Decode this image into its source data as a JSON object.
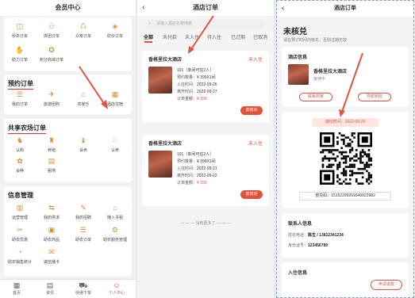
{
  "p1": {
    "title": "会员中心",
    "top_items": [
      {
        "label": "秒杀订单",
        "icon": "bag-icon"
      },
      {
        "label": "拼团订单",
        "icon": "group-icon"
      },
      {
        "label": "众筹订单",
        "icon": "crowd-icon"
      },
      {
        "label": "砍价订单",
        "icon": "tag-icon"
      },
      {
        "label": "助力订单",
        "icon": "hand-icon"
      },
      {
        "label": "积分商城订单",
        "icon": "points-icon"
      }
    ],
    "booking_title": "预约订单",
    "booking_items": [
      {
        "label": "我的订单",
        "icon": "list-icon"
      },
      {
        "label": "旅游团购",
        "icon": "travel-icon"
      },
      {
        "label": "农家乐",
        "icon": "farm-icon"
      },
      {
        "label": "酒店住宿",
        "icon": "hotel-icon"
      }
    ],
    "farm_title": "共享农场订单",
    "farm_items": [
      {
        "label": "认购",
        "icon": "cow-icon"
      },
      {
        "label": "养殖",
        "icon": "pig-icon"
      },
      {
        "label": "会养",
        "icon": "chicken-icon"
      },
      {
        "label": "认养",
        "icon": "sheep-icon"
      },
      {
        "label": "会种",
        "icon": "plant-icon"
      },
      {
        "label": "租地",
        "icon": "field-icon"
      }
    ],
    "info_title": "信息管理",
    "info_items": [
      {
        "label": "运营管理",
        "icon": "chart-icon"
      },
      {
        "label": "我的供求",
        "icon": "supply-icon"
      },
      {
        "label": "我的招聘",
        "icon": "job-icon"
      },
      {
        "label": "摊入寻租",
        "icon": "rent-icon"
      },
      {
        "label": "助农优惠",
        "icon": "coupon-icon"
      },
      {
        "label": "助农商品",
        "icon": "goods-icon"
      },
      {
        "label": "助农订单",
        "icon": "order-icon"
      },
      {
        "label": "助农服务管理",
        "icon": "service-icon"
      },
      {
        "label": "助农销售统计",
        "icon": "stats-icon"
      },
      {
        "label": "诚信播卡",
        "icon": "card-icon"
      }
    ],
    "tabbar": [
      {
        "label": "首页",
        "icon": "grid-icon"
      },
      {
        "label": "资讯",
        "icon": "news-icon"
      },
      {
        "label": "快递下单",
        "icon": "cart-icon"
      },
      {
        "label": "个人中心",
        "icon": "user-icon"
      }
    ]
  },
  "p2": {
    "title": "酒店订单",
    "back": "‹",
    "search_placeholder": "请输入酒店名称搜索",
    "tabs": [
      "全部",
      "未付款",
      "未入住",
      "待入住",
      "已过期",
      "已取消"
    ],
    "orders": [
      {
        "hotel": "香格里拉大酒店",
        "status": "未入住",
        "room": "101（单间可住2人）",
        "qty_label": "预约数量：",
        "qty": "¥ 399X1间",
        "checkin_label": "入住时间：",
        "checkin": "2022-09-26",
        "checkout_label": "离开时间：",
        "checkout": "2022-09-27",
        "amount_label": "订单金额：",
        "amount": "¥ 399",
        "button": "去核对"
      },
      {
        "hotel": "香格里拉大酒店",
        "status": "未入住",
        "room": "101（单间可住2人）",
        "qty_label": "预约数量：",
        "qty": "¥ 399X1间",
        "checkin_label": "入住时间：",
        "checkin": "2022-09-21",
        "checkout_label": "离开时间：",
        "checkout": "2022-09-22",
        "amount_label": "订单金额：",
        "amount": "¥ 399",
        "button": "去核对"
      }
    ],
    "no_more": "没有更多了"
  },
  "p3": {
    "title": "酒店订单",
    "back": "‹",
    "status": "未核兑",
    "status_sub": "请在预订时间内核兑，否则过期无效",
    "hotel_section": "酒店信息",
    "hotel_name": "香格里拉大酒店",
    "hotel_tag": "接待中",
    "contact_btn": "联系商家",
    "nav_btn": "导航到店",
    "date_label": "游玩时间：2022-09-26",
    "code_label": "核兑码：15152209261646022982",
    "contact_section": "联系人信息",
    "name_label": "姓名电话：",
    "name_value": "陈生 / 13812341234",
    "id_label": "身份证号：",
    "id_value": "123456789",
    "checkin_section": "入住信息",
    "refund_btn": "申请退款",
    "accent": "#e0533f"
  }
}
